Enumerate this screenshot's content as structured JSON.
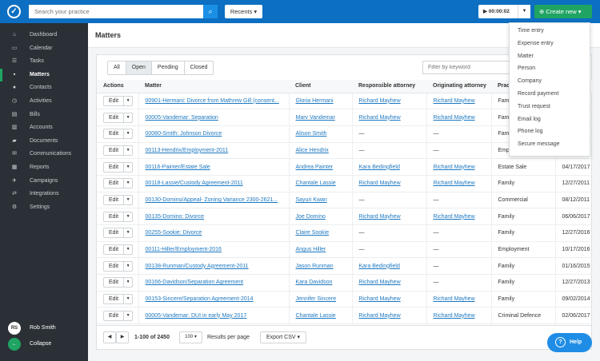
{
  "topbar": {
    "search_placeholder": "Search your practice",
    "recents": "Recents ▾",
    "timer": "▶ 00:00:02",
    "create_new": "⊕ Create new ▾"
  },
  "sidebar": {
    "items": [
      {
        "label": "Dashboard",
        "icon": "⌂"
      },
      {
        "label": "Calendar",
        "icon": "▭"
      },
      {
        "label": "Tasks",
        "icon": "☰"
      },
      {
        "label": "Matters",
        "icon": "▪"
      },
      {
        "label": "Contacts",
        "icon": "●"
      },
      {
        "label": "Activities",
        "icon": "◷"
      },
      {
        "label": "Bills",
        "icon": "▤"
      },
      {
        "label": "Accounts",
        "icon": "▥"
      },
      {
        "label": "Documents",
        "icon": "▰"
      },
      {
        "label": "Communications",
        "icon": "✉"
      },
      {
        "label": "Reports",
        "icon": "▦"
      },
      {
        "label": "Campaigns",
        "icon": "✈"
      },
      {
        "label": "Integrations",
        "icon": "⇄"
      },
      {
        "label": "Settings",
        "icon": "⚙"
      }
    ],
    "user_initials": "RS",
    "user_name": "Rob Smith",
    "collapse": "Collapse"
  },
  "page_title": "Matters",
  "tabs": [
    "All",
    "Open",
    "Pending",
    "Closed"
  ],
  "filter_placeholder": "Filter by keyword",
  "columns": [
    "Actions",
    "Matter",
    "Client",
    "Responsible attorney",
    "Originating attorney",
    "Practice area",
    ""
  ],
  "edit_label": "Edit",
  "rows": [
    [
      "00901-Hermani: Divorce from Mathrew Gill (consent...",
      "Gloria Hermani",
      "Richard Mayhew",
      "Richard Mayhew",
      "Family",
      ""
    ],
    [
      "00005-Vandemar: Separation",
      "Marv Vandemar",
      "Richard Mayhew",
      "Richard Mayhew",
      "Family",
      ""
    ],
    [
      "00080-Smith: Johnson Divorce",
      "Alison Smith",
      "—",
      "—",
      "Family",
      ""
    ],
    [
      "00113-Hendrix/Employment-2011",
      "Alice Hendrix",
      "—",
      "—",
      "Employment",
      ""
    ],
    [
      "00116-Painter/Estate Sale",
      "Andrea Painter",
      "Kara Bedingfield",
      "Richard Mayhew",
      "Estate Sale",
      "04/17/2017"
    ],
    [
      "00118-Lassie/Custody Agreement-2011",
      "Chantale Lassie",
      "Richard Mayhew",
      "Richard Mayhew",
      "Family",
      "12/27/2011"
    ],
    [
      "00130-Domino/Appeal- Zoning Variance 2300-2621...",
      "Sayuri Kwan",
      "—",
      "—",
      "Commercial",
      "08/12/2011"
    ],
    [
      "00135-Domino: Divorce",
      "Joe Domino",
      "Richard Mayhew",
      "Richard Mayhew",
      "Family",
      "06/06/2017"
    ],
    [
      "00255-Sookie: Divorce",
      "Claire Sookie",
      "—",
      "—",
      "Family",
      "12/27/2016"
    ],
    [
      "00111-Hiller/Employment-2016",
      "Angus Hiller",
      "—",
      "—",
      "Employment",
      "10/17/2016"
    ],
    [
      "00138-Runman/Custody Agreement-2011",
      "Jason Runman",
      "Kara Bedingfield",
      "—",
      "Family",
      "01/16/2015"
    ],
    [
      "00166-Davidson/Separation Agreement",
      "Kara Davidson",
      "Richard Mayhew",
      "—",
      "Family",
      "12/27/2013"
    ],
    [
      "00153-Sincere/Separation Agreement-2014",
      "Jennifer Sincere",
      "Richard Mayhew",
      "Richard Mayhew",
      "Family",
      "09/02/2014"
    ],
    [
      "00005-Vandemar: DUI in early May 2017",
      "Chantale Lassie",
      "Richard Mayhew",
      "Richard Mayhew",
      "Criminal Defence",
      "02/06/2017"
    ]
  ],
  "footer": {
    "range": "1-100 of 2450",
    "per_page": "100 ▾",
    "per_page_label": "Results per page",
    "export": "Export CSV ▾"
  },
  "create_menu": [
    "Time entry",
    "Expense entry",
    "Matter",
    "Person",
    "Company",
    "Record payment",
    "Trust request",
    "Email log",
    "Phone log",
    "Secure message"
  ],
  "help": "Help",
  "colors": {
    "brand": "#0c6fc2",
    "green": "#1fa463",
    "sidebar": "#2a3035",
    "link": "#1d78c1"
  }
}
